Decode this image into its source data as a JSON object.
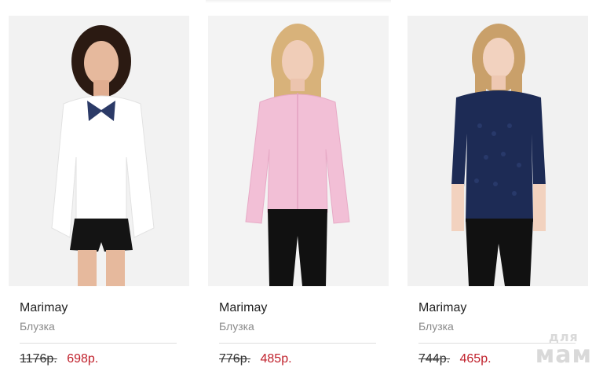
{
  "products": [
    {
      "brand": "Marimay",
      "type": "Блузка",
      "old_price": "1176р.",
      "new_price": "698р.",
      "image": {
        "icon": "woman-white-blouse-bow-photo",
        "garment_color": "#ffffff",
        "accent_color": "#2b3a67"
      }
    },
    {
      "brand": "Marimay",
      "type": "Блузка",
      "old_price": "776р.",
      "new_price": "485р.",
      "image": {
        "icon": "woman-pink-shirt-photo",
        "garment_color": "#f2bfd6"
      }
    },
    {
      "brand": "Marimay",
      "type": "Блузка",
      "old_price": "744р.",
      "new_price": "465р.",
      "image": {
        "icon": "woman-navy-lace-blouse-photo",
        "garment_color": "#1d2b55"
      }
    }
  ],
  "watermark": {
    "line1": "для",
    "line2": "мам"
  },
  "colors": {
    "sale_price": "#c0202b",
    "old_price": "#333333",
    "brand_text": "#222222",
    "type_text": "#8a8a8a"
  }
}
